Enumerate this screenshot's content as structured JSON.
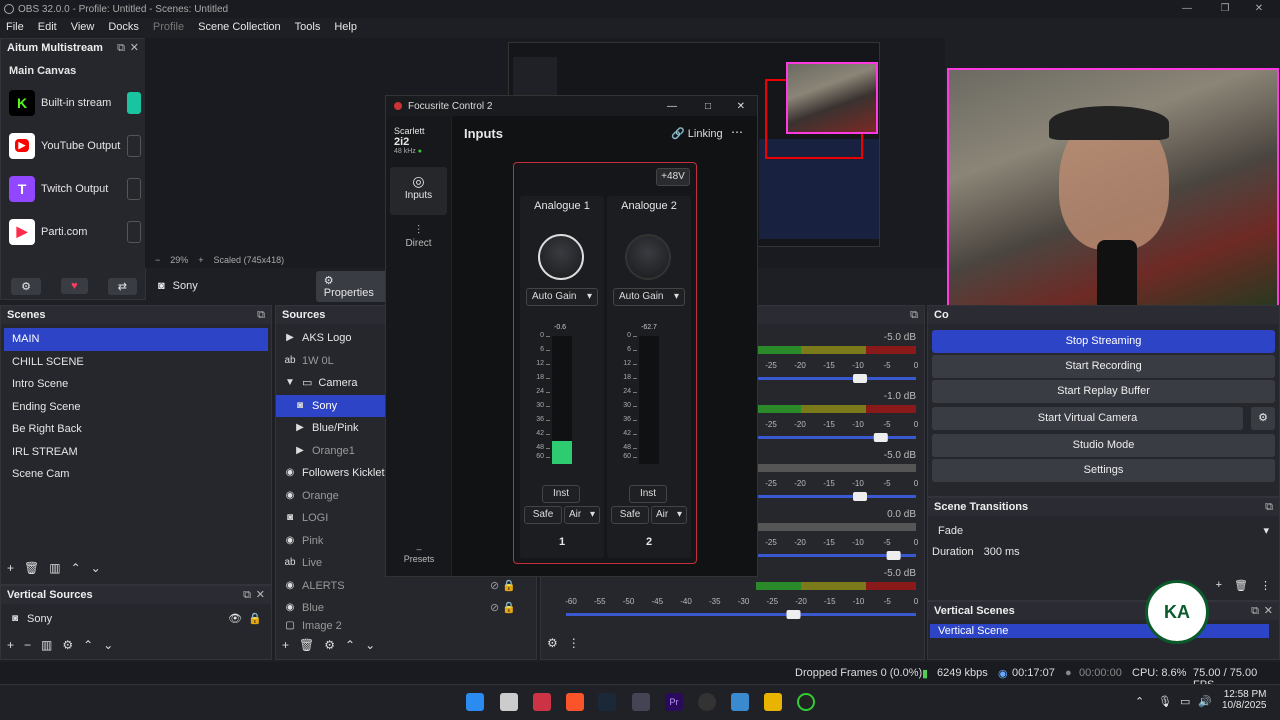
{
  "window": {
    "title": "OBS 32.0.0 - Profile: Untitled - Scenes: Untitled"
  },
  "menu": [
    "File",
    "Edit",
    "View",
    "Docks",
    "Profile",
    "Scene Collection",
    "Tools",
    "Help"
  ],
  "multistream": {
    "title": "Aitum Multistream",
    "canvas": "Main Canvas",
    "outputs": [
      {
        "label": "Built-in stream",
        "color": "#53fc18",
        "glyph": "K"
      },
      {
        "label": "YouTube Output",
        "color": "#ff0000",
        "glyph": "▶"
      },
      {
        "label": "Twitch Output",
        "color": "#9146ff",
        "glyph": "T"
      },
      {
        "label": "Parti.com",
        "color": "#ff2b4a",
        "glyph": "P"
      }
    ]
  },
  "preview_zoom": {
    "percent": "29%",
    "scaled": "Scaled (745x418)"
  },
  "source_bar": {
    "name": "Sony",
    "properties": "Properties"
  },
  "scenes": {
    "title": "Scenes",
    "items": [
      "MAIN",
      "CHILL SCENE",
      "Intro Scene",
      "Ending Scene",
      "Be Right Back",
      "IRL STREAM",
      "Scene  Cam"
    ],
    "selected": 0
  },
  "sources": {
    "title": "Sources",
    "items": [
      {
        "label": "AKS Logo",
        "icon": "▶"
      },
      {
        "label": "1W 0L",
        "icon": "ab",
        "dim": true
      },
      {
        "label": "Camera",
        "icon": "▼"
      },
      {
        "label": "Sony",
        "icon": "◎",
        "sel": true
      },
      {
        "label": "Blue/Pink",
        "icon": "▶"
      },
      {
        "label": "Orange1",
        "icon": "▶",
        "dim": true
      },
      {
        "label": "Followers Kicklet",
        "icon": "◉"
      },
      {
        "label": "Orange",
        "icon": "◉",
        "dim": true
      },
      {
        "label": "LOGI",
        "icon": "◎",
        "dim": true
      },
      {
        "label": "Pink",
        "icon": "◉",
        "dim": true
      },
      {
        "label": "Live",
        "icon": "ab",
        "dim": true
      },
      {
        "label": "ALERTS",
        "icon": "◉",
        "dim": true
      },
      {
        "label": "Blue",
        "icon": "◉",
        "dim": true
      },
      {
        "label": "Image 2",
        "icon": "▢",
        "dim": true
      }
    ]
  },
  "vertical_sources": {
    "title": "Vertical Sources",
    "items": [
      "Sony"
    ]
  },
  "focusrite": {
    "title": "Focusrite Control 2",
    "device": "Scarlett",
    "model": "2i2",
    "rate": "48 kHz",
    "heading": "Inputs",
    "linking": "Linking",
    "phantom": "+48V",
    "nav": [
      "Inputs",
      "Direct"
    ],
    "presets": "Presets",
    "channels": [
      {
        "name": "Analogue 1",
        "gain_mode": "Auto Gain",
        "peak": "-0.6",
        "level": 0.18,
        "number": "1"
      },
      {
        "name": "Analogue 2",
        "gain_mode": "Auto Gain",
        "peak": "-62.7",
        "level": 0.0,
        "number": "2"
      }
    ],
    "scale": [
      "0",
      "6",
      "12",
      "18",
      "24",
      "30",
      "36",
      "42",
      "48",
      "60"
    ],
    "inst": "Inst",
    "safe": "Safe",
    "air": "Air"
  },
  "mixer": {
    "db": [
      "-5.0 dB",
      "-1.0 dB",
      "-5.0 dB",
      "0.0 dB",
      "-5.0 dB"
    ],
    "ticks": [
      "-25",
      "-20",
      "-15",
      "-10",
      "-5",
      "0"
    ],
    "full_ticks": [
      "-60",
      "-55",
      "-50",
      "-45",
      "-40",
      "-35",
      "-30",
      "-25",
      "-20",
      "-15",
      "-10",
      "-5",
      "0"
    ]
  },
  "controls": {
    "title": "Co",
    "buttons": [
      "Stop Streaming",
      "Start Recording",
      "Start Replay Buffer",
      "Start Virtual Camera",
      "Studio Mode",
      "Settings"
    ]
  },
  "transitions": {
    "title": "Scene Transitions",
    "type": "Fade",
    "duration_label": "Duration",
    "duration": "300 ms"
  },
  "vertical_scenes": {
    "title": "Vertical Scenes",
    "items": [
      "Vertical Scene"
    ]
  },
  "status": {
    "dropped": "Dropped Frames 0 (0.0%)",
    "kbps": "6249 kbps",
    "stream_time": "00:17:07",
    "rec_time": "00:00:00",
    "cpu": "CPU: 8.6%",
    "fps": "75.00 / 75.00 FPS"
  },
  "clock": {
    "time": "12:58 PM",
    "date": "10/8/2025"
  },
  "watermark": {
    "text": "KA"
  }
}
